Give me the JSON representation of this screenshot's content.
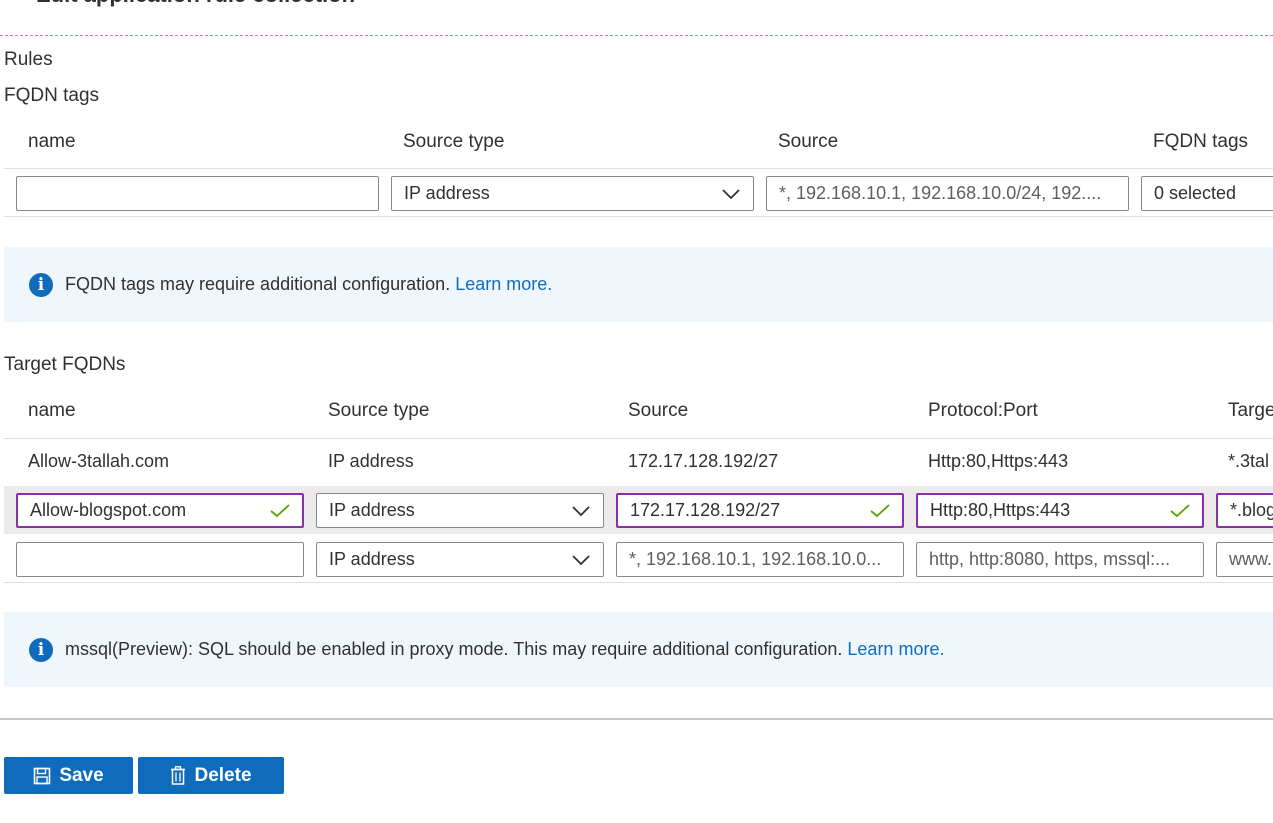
{
  "page": {
    "title": "Edit application rule collection"
  },
  "rules": {
    "label": "Rules"
  },
  "fqdn_tags": {
    "label": "FQDN tags",
    "columns": [
      "name",
      "Source type",
      "Source",
      "FQDN tags"
    ],
    "row": {
      "name_value": "",
      "source_type": "IP address",
      "source_placeholder": "*, 192.168.10.1, 192.168.10.0/24, 192....",
      "tags_value": "0 selected"
    },
    "info": {
      "text": "FQDN tags may require additional configuration.",
      "link": "Learn more."
    }
  },
  "target_fqdns": {
    "label": "Target FQDNs",
    "columns": [
      "name",
      "Source type",
      "Source",
      "Protocol:Port",
      "Targe"
    ],
    "rows": [
      {
        "name": "Allow-3tallah.com",
        "source_type": "IP address",
        "source": "172.17.128.192/27",
        "protocol_port": "Http:80,Https:443",
        "target": "*.3tal"
      },
      {
        "name": "Allow-blogspot.com",
        "source_type": "IP address",
        "source": "172.17.128.192/27",
        "protocol_port": "Http:80,Https:443",
        "target": "*.blog"
      },
      {
        "name": "",
        "source_type": "IP address",
        "source_placeholder": "*, 192.168.10.1, 192.168.10.0...",
        "protocol_placeholder": "http, http:8080, https, mssql:...",
        "target_placeholder": "www."
      }
    ],
    "info": {
      "text": "mssql(Preview): SQL should be enabled in proxy mode. This may require additional configuration.",
      "link": "Learn more."
    }
  },
  "actions": {
    "save_label": "Save",
    "delete_label": "Delete"
  },
  "colors": {
    "accent": "#0f6cbd",
    "valid_border": "#8b2fa8",
    "valid_check": "#57a300",
    "info_bg": "#eff6fc"
  },
  "icons": [
    "info-icon",
    "chevron-down-icon",
    "checkmark-icon",
    "save-icon",
    "trash-icon"
  ]
}
